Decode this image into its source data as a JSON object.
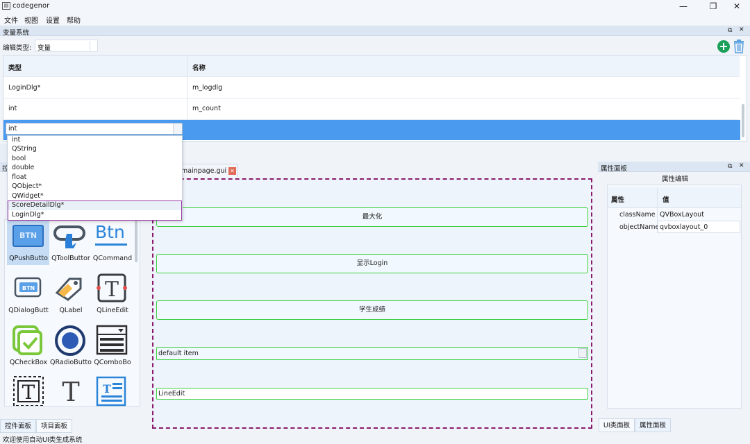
{
  "window": {
    "title": "codegenor",
    "minimize_glyph": "—",
    "restore_glyph": "❐",
    "close_glyph": "✕"
  },
  "menu": [
    "文件",
    "视图",
    "设置",
    "帮助"
  ],
  "variable_dock": {
    "title": "变量系统",
    "edit_type_label": "编辑类型:",
    "edit_type_value": "变量",
    "add_glyph": "+",
    "columns": [
      "类型",
      "名称"
    ],
    "rows": [
      {
        "type": "LoginDlg*",
        "name": "m_logdlg"
      },
      {
        "type": "int",
        "name": "m_count"
      }
    ],
    "editing_value": "int",
    "type_options": [
      "int",
      "QString",
      "bool",
      "double",
      "float",
      "QObject*",
      "QWidget*",
      "ScoreDetailDlg*",
      "LoginDlg*"
    ]
  },
  "left_dock": {
    "title_fragment": "控",
    "widgets": [
      {
        "label": "QPushButto",
        "icon": "pushbutton-icon"
      },
      {
        "label": "QToolButtor",
        "icon": "toolbutton-icon"
      },
      {
        "label": "QCommand",
        "icon": "commandlink-icon"
      },
      {
        "label": "QDialogButt",
        "icon": "dialogbutton-icon"
      },
      {
        "label": "QLabel",
        "icon": "label-icon"
      },
      {
        "label": "QLineEdit",
        "icon": "lineedit-icon"
      },
      {
        "label": "QCheckBox",
        "icon": "checkbox-icon"
      },
      {
        "label": "QRadioButto",
        "icon": "radiobutton-icon"
      },
      {
        "label": "QComboBo",
        "icon": "combobox-icon"
      },
      {
        "label": "",
        "icon": "textedit-icon"
      },
      {
        "label": "",
        "icon": "plaintext-icon"
      },
      {
        "label": "",
        "icon": "textbrowser-icon"
      }
    ],
    "pushbutton_icon_text": "BTN",
    "command_icon_text": "Btn",
    "tabs": [
      "控件面板",
      "项目面板"
    ]
  },
  "editor": {
    "tab_label": "mainpage.gui",
    "tab_close_glyph": "✕",
    "buttons": [
      "最大化",
      "显示Login",
      "学生成绩"
    ],
    "combo_text": "default item",
    "lineedit_text": "LineEdit"
  },
  "property_dock": {
    "title": "属性面板",
    "group_title": "属性编辑",
    "columns": [
      "属性",
      "值"
    ],
    "rows": [
      {
        "key": "className",
        "value": "QVBoxLayout"
      },
      {
        "key": "objectName",
        "value": "qvboxlayout_0"
      }
    ],
    "tabs": [
      "UI类面板",
      "属性面板"
    ]
  },
  "status_bar": "欢迎使用自动UI类生成系统",
  "colors": {
    "selection": "#4a9bf0",
    "canvas_border": "#8a1a6a",
    "button_border": "#3ccf3c",
    "add_button": "#1ba05a",
    "trash": "#5a9fe0"
  }
}
